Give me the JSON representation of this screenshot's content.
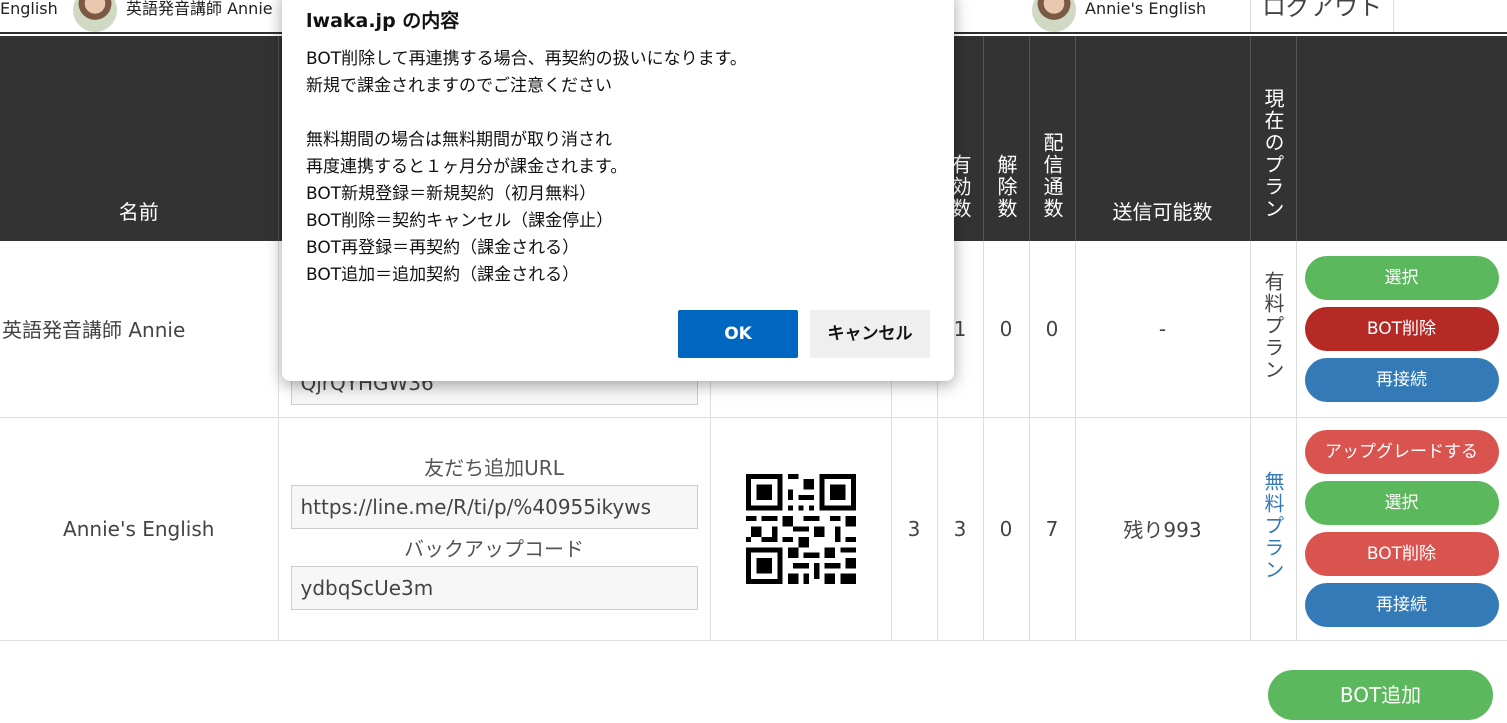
{
  "topbar": {
    "left_text": "English",
    "account1": "英語発音講師 Annie",
    "account2": "Annie's English",
    "logout": "ログアウト"
  },
  "table": {
    "headers": {
      "name": "名前",
      "valid": "有効数",
      "cancel": "解除数",
      "delivered": "配信通数",
      "sendable": "送信可能数",
      "plan": "現在のプラン"
    },
    "rows": [
      {
        "name": "英語発音講師 Annie",
        "backup_code": "QjrQYHGW36",
        "valid": "1",
        "cancel": "0",
        "delivered": "0",
        "sendable": "-",
        "plan": "有料プラン",
        "buttons": {
          "select": "選択",
          "delete": "BOT削除",
          "reconnect": "再接続"
        }
      },
      {
        "name": "Annie's English",
        "url_label": "友だち追加URL",
        "url": "https://line.me/R/ti/p/%40955ikyws",
        "backup_label": "バックアップコード",
        "backup_code": "ydbqScUe3m",
        "friends": "3",
        "valid": "3",
        "cancel": "0",
        "delivered": "7",
        "sendable": "残り993",
        "plan": "無料プラン",
        "buttons": {
          "upgrade": "アップグレードする",
          "select": "選択",
          "delete": "BOT削除",
          "reconnect": "再接続"
        }
      }
    ]
  },
  "bot_add": "BOT追加",
  "dialog": {
    "title": "lwaka.jp の内容",
    "body": "BOT削除して再連携する場合、再契約の扱いになります。\n新規で課金されますのでご注意ください\n\n無料期間の場合は無料期間が取り消され\n再度連携すると１ヶ月分が課金されます。\nBOT新規登録＝新規契約（初月無料）\nBOT削除＝契約キャンセル（課金停止）\nBOT再登録＝再契約（課金される）\nBOT追加＝追加契約（課金される）",
    "ok": "OK",
    "cancel": "キャンセル"
  }
}
